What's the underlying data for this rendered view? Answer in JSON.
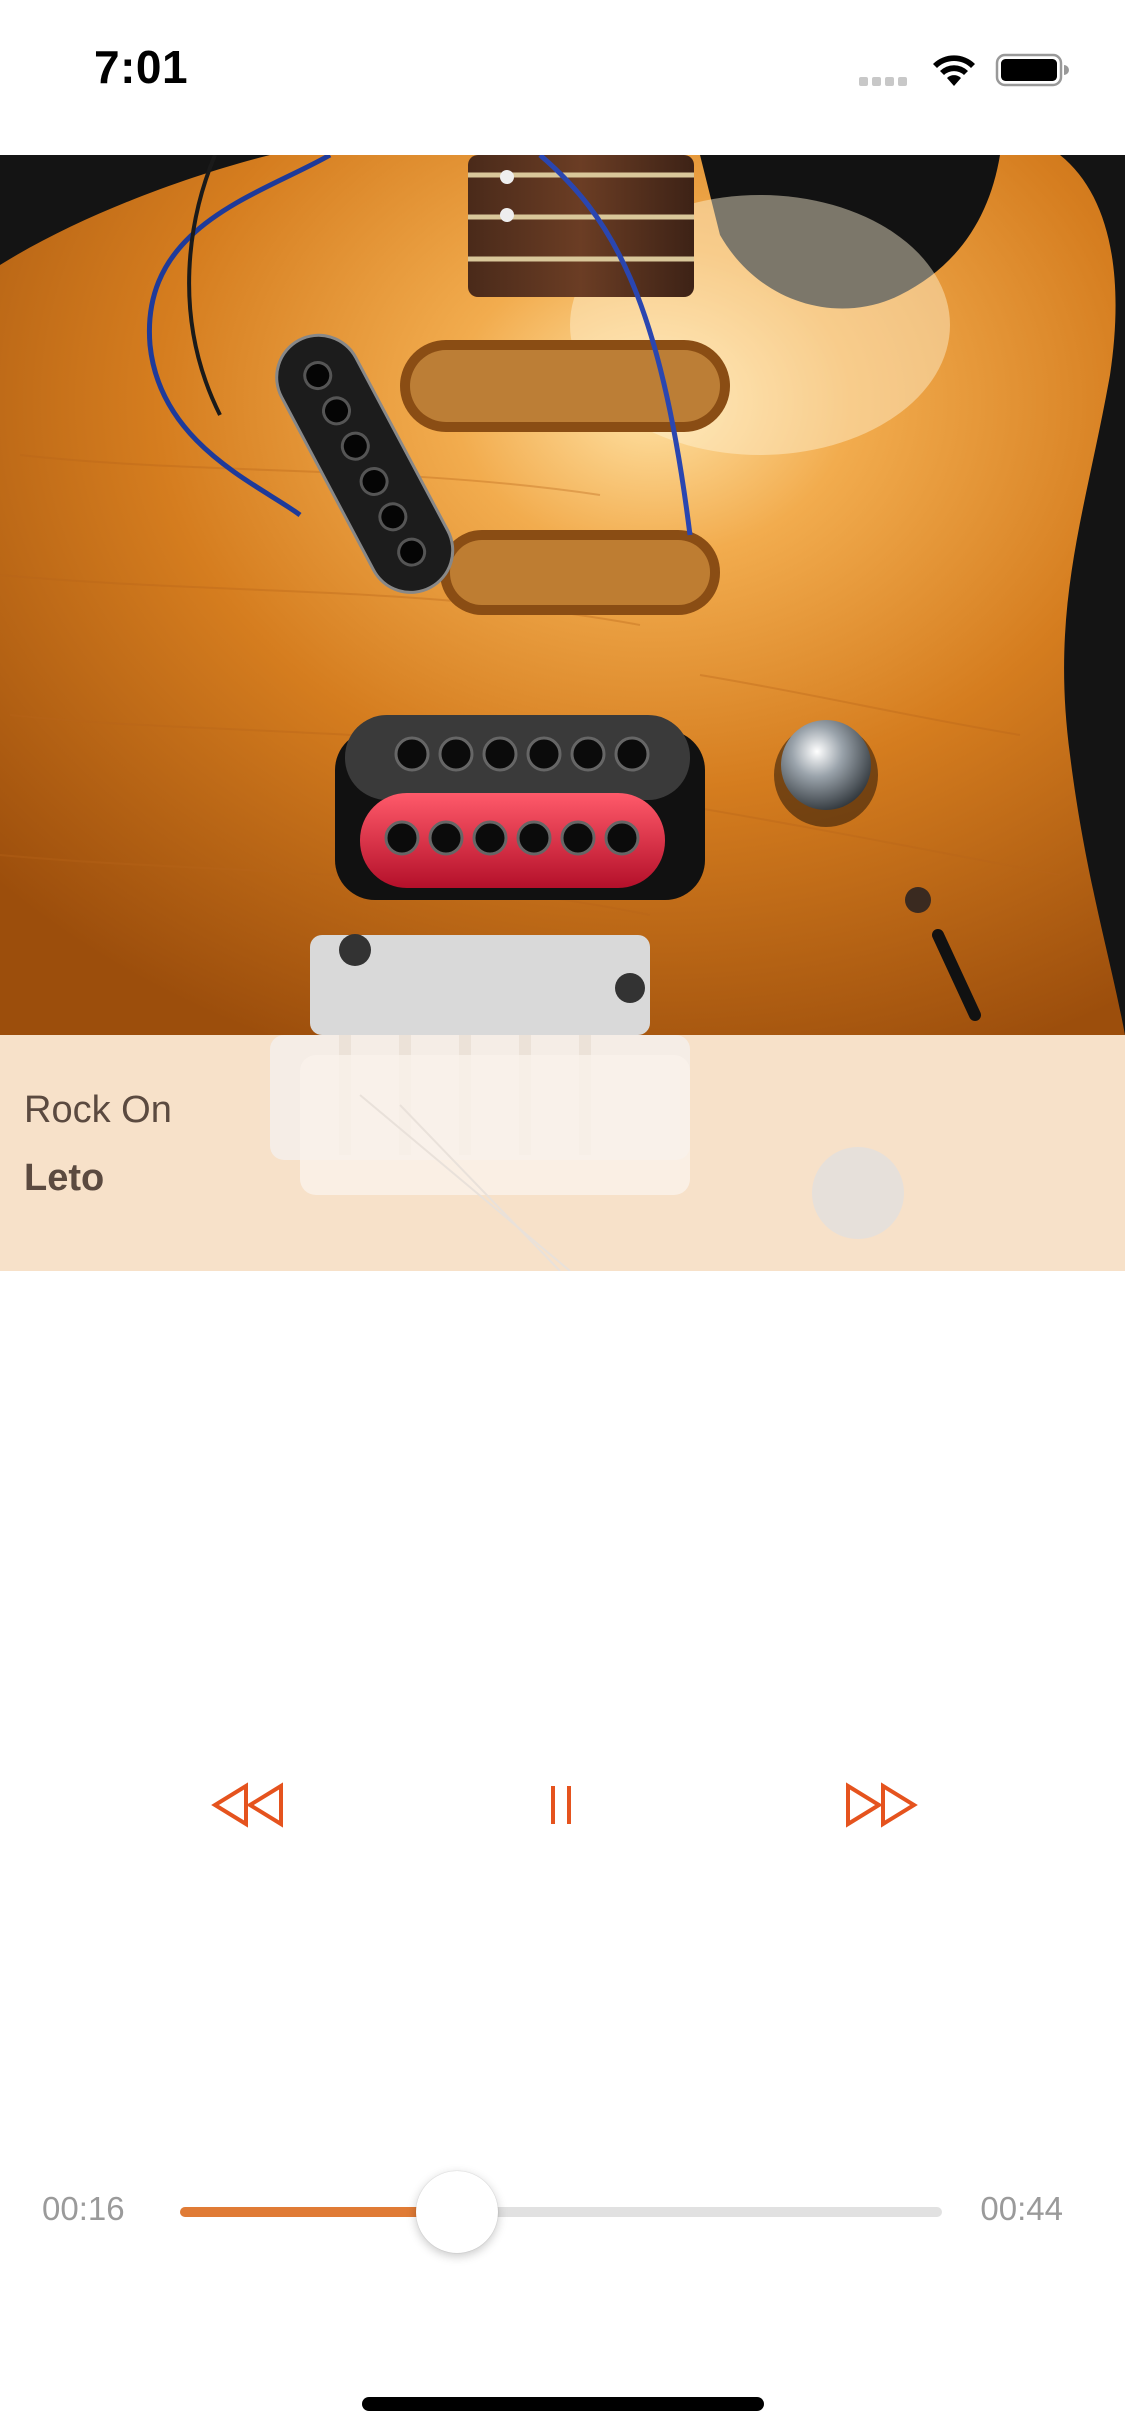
{
  "status_bar": {
    "time": "7:01",
    "icons": [
      "cellular-signal-icon",
      "wifi-icon",
      "battery-icon"
    ]
  },
  "artwork": {
    "description_icon": "album-artwork"
  },
  "track": {
    "title": "Rock On",
    "artist": "Leto"
  },
  "controls": {
    "rewind_icon": "rewind-icon",
    "pause_icon": "pause-icon",
    "forward_icon": "fast-forward-icon"
  },
  "progress": {
    "elapsed": "00:16",
    "total": "00:44",
    "fraction": 0.3636
  },
  "colors": {
    "accent": "#e5531e",
    "progress_fill": "#e07b35",
    "track_text": "#5b4a40",
    "time_text": "#9a9a9a"
  }
}
